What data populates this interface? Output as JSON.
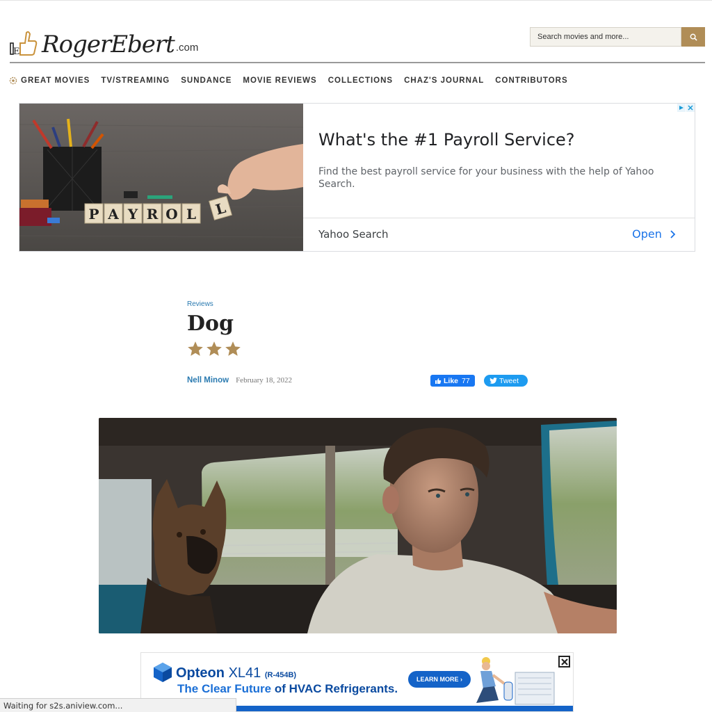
{
  "header": {
    "logo_text": "RogerEbert",
    "logo_suffix": ".com",
    "search_placeholder": "Search movies and more..."
  },
  "nav": {
    "items": [
      {
        "label": "GREAT MOVIES"
      },
      {
        "label": "TV/STREAMING"
      },
      {
        "label": "SUNDANCE"
      },
      {
        "label": "MOVIE REVIEWS"
      },
      {
        "label": "COLLECTIONS"
      },
      {
        "label": "CHAZ'S JOURNAL"
      },
      {
        "label": "CONTRIBUTORS"
      }
    ]
  },
  "ad_top": {
    "image_text": "PAYROLL",
    "title": "What's the #1 Payroll Service?",
    "description": "Find the best payroll service for your business with the help of Yahoo Search.",
    "source": "Yahoo Search",
    "cta": "Open"
  },
  "article": {
    "category": "Reviews",
    "title": "Dog",
    "rating": 3,
    "author": "Nell Minow",
    "date": "February 18, 2022",
    "fb_like_label": "Like",
    "fb_like_count": "77",
    "tweet_label": "Tweet"
  },
  "ad_bottom": {
    "brand": "Opteon",
    "model": "XL41",
    "code": "(R-454B)",
    "tagline_start": "The Clear Future",
    "tagline_end": "of HVAC Refrigerants.",
    "cta": "LEARN MORE ›"
  },
  "status_bar": {
    "text": "Waiting for s2s.aniview.com..."
  },
  "colors": {
    "accent_gold": "#b08d57",
    "link_blue": "#2a7ab0",
    "facebook_blue": "#1877f2",
    "twitter_blue": "#1d9bf0",
    "ad_link_blue": "#1a73e8"
  }
}
